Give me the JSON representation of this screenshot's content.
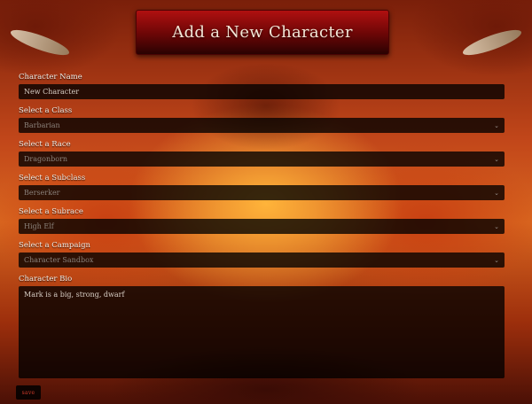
{
  "page": {
    "title": "Add a New Character"
  },
  "form": {
    "name": {
      "label": "Character Name",
      "value": "New Character"
    },
    "class": {
      "label": "Select a Class",
      "value": "Barbarian"
    },
    "race": {
      "label": "Select a Race",
      "value": "Dragonborn"
    },
    "subclass": {
      "label": "Select a Subclass",
      "value": "Berserker"
    },
    "subrace": {
      "label": "Select a Subrace",
      "value": "High Elf"
    },
    "campaign": {
      "label": "Select a Campaign",
      "value": "Character Sandbox"
    },
    "bio": {
      "label": "Character Bio",
      "value": "Mark is a big, strong, dwarf"
    },
    "save_label": "save"
  },
  "icons": {
    "dropdown": "chevron-down-icon"
  },
  "colors": {
    "banner_red": "#b01010",
    "save_text": "#d13a2a"
  }
}
